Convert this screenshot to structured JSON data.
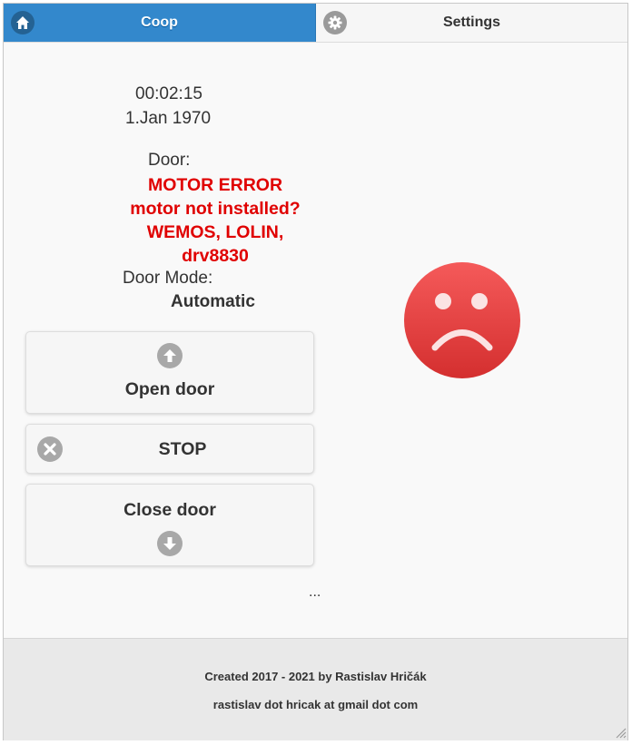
{
  "tabs": {
    "coop": {
      "label": "Coop",
      "icon": "home-icon",
      "active": true
    },
    "settings": {
      "label": "Settings",
      "icon": "gear-icon",
      "active": false
    }
  },
  "status": {
    "time": "00:02:15",
    "date": "1.Jan 1970",
    "door_label": "Door:",
    "door_error_lines": [
      "MOTOR ERROR",
      "motor not installed?",
      "WEMOS, LOLIN,",
      "drv8830"
    ],
    "door_mode_label": "Door Mode:",
    "door_mode_value": "Automatic",
    "ellipsis": "...",
    "face_icon": "sad-face-icon"
  },
  "buttons": {
    "open": {
      "label": "Open door",
      "icon": "arrow-up-icon"
    },
    "stop": {
      "label": "STOP",
      "icon": "close-icon"
    },
    "close": {
      "label": "Close door",
      "icon": "arrow-down-icon"
    }
  },
  "footer": {
    "credit": "Created 2017 - 2021 by Rastislav Hričák",
    "email": "rastislav dot hricak at gmail dot com"
  },
  "colors": {
    "accent": "#3388cc",
    "error": "#e00000",
    "sad_face_top": "#f55a5a",
    "sad_face_bottom": "#d42f2f"
  }
}
